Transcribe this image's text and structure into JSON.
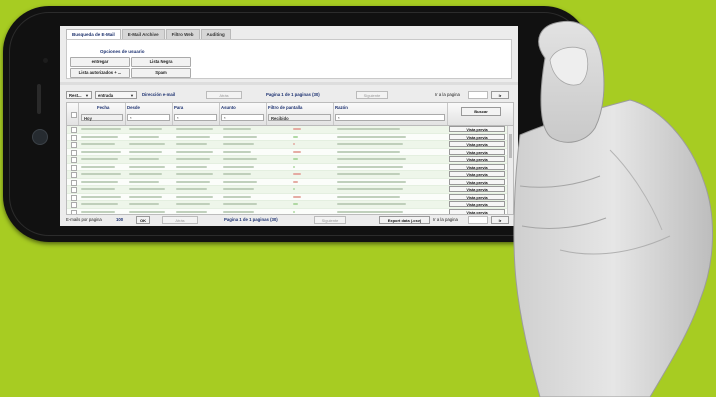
{
  "tabs": [
    "Busqueda de E-Mail",
    "E-Mail Archive",
    "Filtro Web",
    "Auditing"
  ],
  "options": {
    "title": "Opciones de usuario",
    "buttons": [
      "entregar",
      "Lista Negra",
      "Lista autorizados + ...",
      "Spam"
    ]
  },
  "toolbar": {
    "reset": "Rest...",
    "direction": "entrada",
    "address_label": "Dirección e-mail",
    "prev": "Atrás",
    "page_info": "Pagina 1 de 1 paginas (30)",
    "next": "Siguiente",
    "goto_label": "Ir a la pagina",
    "go": "Ir"
  },
  "grid": {
    "columns": [
      "Fecha",
      "Desde",
      "Para",
      "Asunto",
      "Filtro de pantalla",
      "Razón"
    ],
    "date_filter": "Hoy",
    "wildcard": "*",
    "screen_filter": "Recibido",
    "search": "Buscar",
    "row_action": "Vista previa",
    "row_count": 15
  },
  "footer": {
    "per_page_label": "E-mails por pagina",
    "per_page": "100",
    "ok": "OK",
    "prev": "Atrás",
    "page_info": "Pagina 1 de 1 paginas (30)",
    "next": "Siguiente",
    "export": "Export data (.csv)",
    "goto_label": "Ir a la pagina",
    "go": "Ir"
  },
  "colors": {
    "background": "#a7cc22",
    "phone": "#111111",
    "accent": "#1b3070"
  }
}
